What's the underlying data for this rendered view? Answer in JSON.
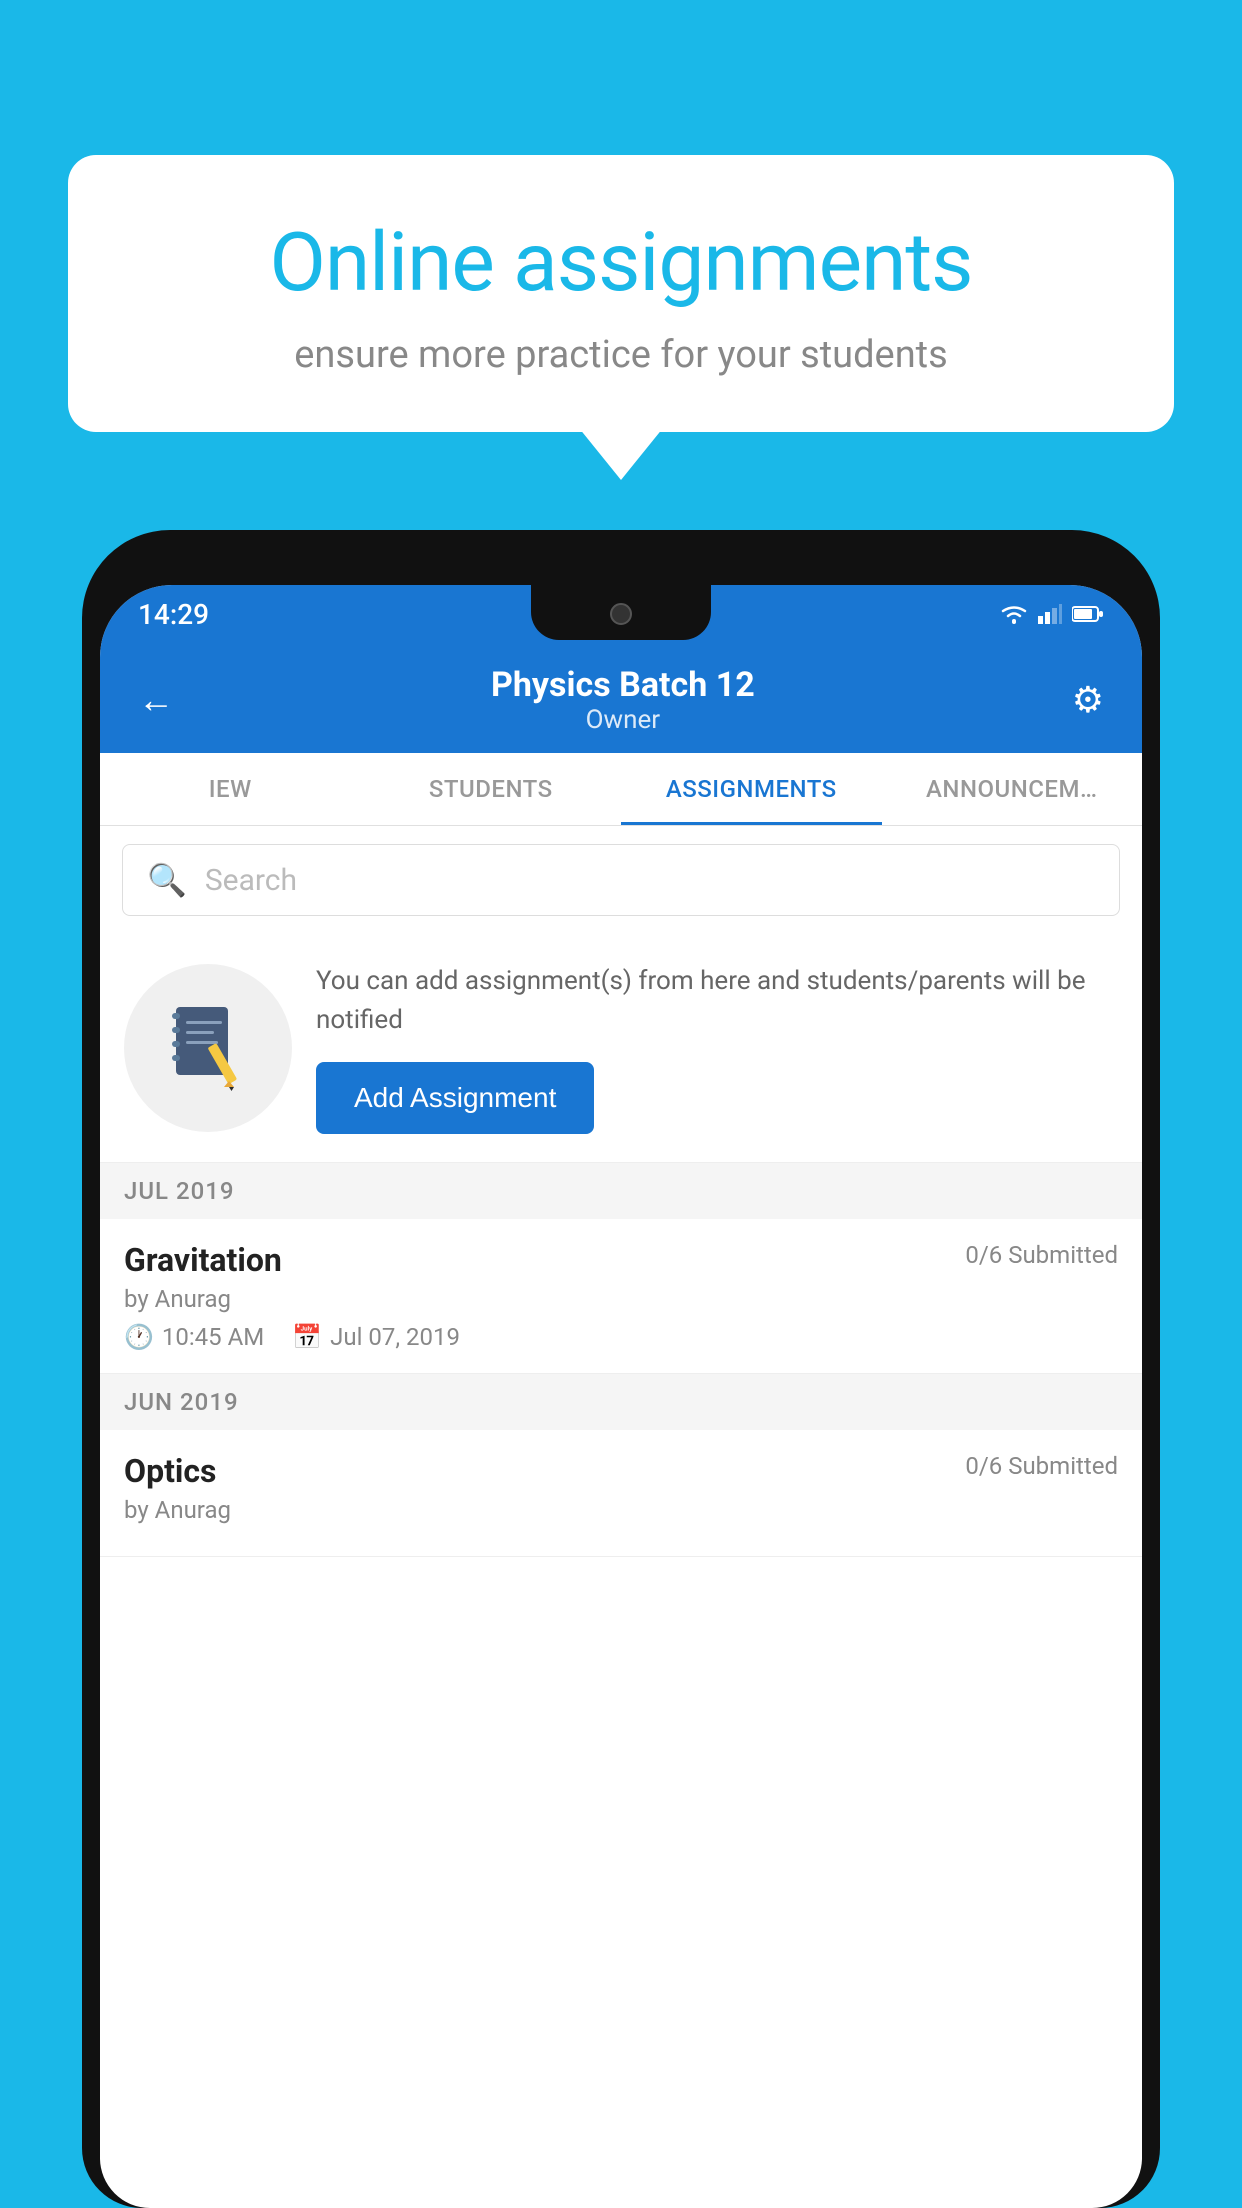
{
  "background": {
    "color": "#1ab8e8"
  },
  "speech_bubble": {
    "title": "Online assignments",
    "subtitle": "ensure more practice for your students"
  },
  "status_bar": {
    "time": "14:29"
  },
  "header": {
    "title": "Physics Batch 12",
    "subtitle": "Owner",
    "back_label": "←",
    "settings_label": "⚙"
  },
  "tabs": [
    {
      "label": "IEW",
      "active": false
    },
    {
      "label": "STUDENTS",
      "active": false
    },
    {
      "label": "ASSIGNMENTS",
      "active": true
    },
    {
      "label": "ANNOUNCEM…",
      "active": false
    }
  ],
  "search": {
    "placeholder": "Search"
  },
  "promo": {
    "text": "You can add assignment(s) from here and students/parents will be notified",
    "button_label": "Add Assignment"
  },
  "sections": [
    {
      "month": "JUL 2019",
      "assignments": [
        {
          "name": "Gravitation",
          "submitted": "0/6 Submitted",
          "by": "by Anurag",
          "time": "10:45 AM",
          "date": "Jul 07, 2019"
        }
      ]
    },
    {
      "month": "JUN 2019",
      "assignments": [
        {
          "name": "Optics",
          "submitted": "0/6 Submitted",
          "by": "by Anurag",
          "time": "",
          "date": ""
        }
      ]
    }
  ]
}
